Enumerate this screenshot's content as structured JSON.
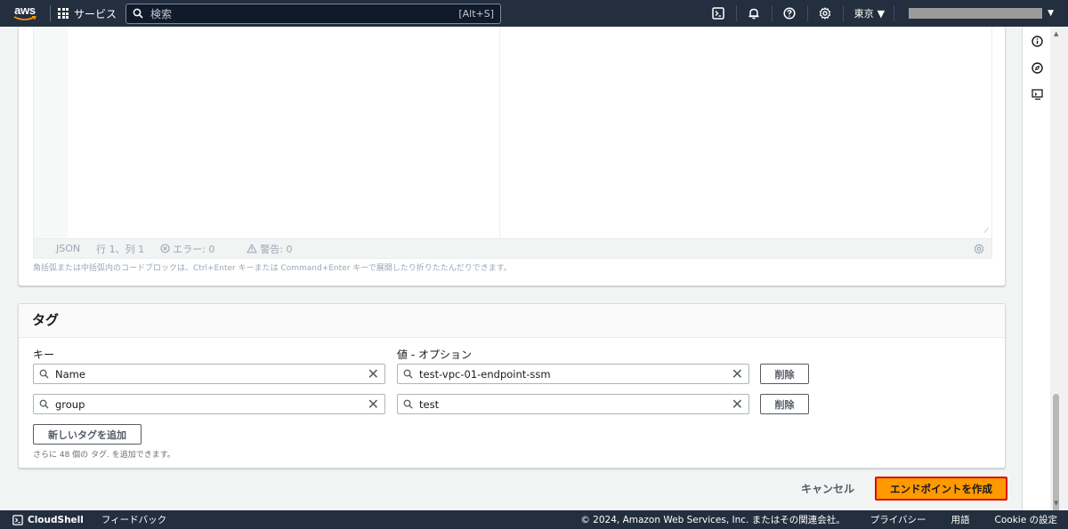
{
  "topnav": {
    "logo": "aws",
    "services_label": "サービス",
    "search_placeholder": "検索",
    "search_shortcut": "[Alt+S]",
    "region": "東京"
  },
  "editor": {
    "status_mode": "JSON",
    "status_position": "行 1、列 1",
    "status_errors": "エラー: 0",
    "status_warnings": "警告: 0",
    "hint": "角括弧または中括弧内のコードブロックは、Ctrl+Enter キーまたは Command+Enter キーで展開したり折りたたんだりできます。"
  },
  "tags": {
    "title": "タグ",
    "key_label": "キー",
    "value_label": "値 - オプション",
    "rows": [
      {
        "key": "Name",
        "value": "test-vpc-01-endpoint-ssm",
        "remove": "削除"
      },
      {
        "key": "group",
        "value": "test",
        "remove": "削除"
      }
    ],
    "add_button": "新しいタグを追加",
    "note": "さらに 48 個の タグ. を追加できます。"
  },
  "actions": {
    "cancel": "キャンセル",
    "create": "エンドポイントを作成"
  },
  "footer": {
    "cloudshell": "CloudShell",
    "feedback": "フィードバック",
    "copyright": "© 2024, Amazon Web Services, Inc. またはその関連会社。",
    "privacy": "プライバシー",
    "terms": "用語",
    "cookie": "Cookie の設定"
  },
  "colors": {
    "nav_bg": "#232f3e",
    "primary_button": "#ff9900",
    "highlight_border": "#e00b0b"
  }
}
